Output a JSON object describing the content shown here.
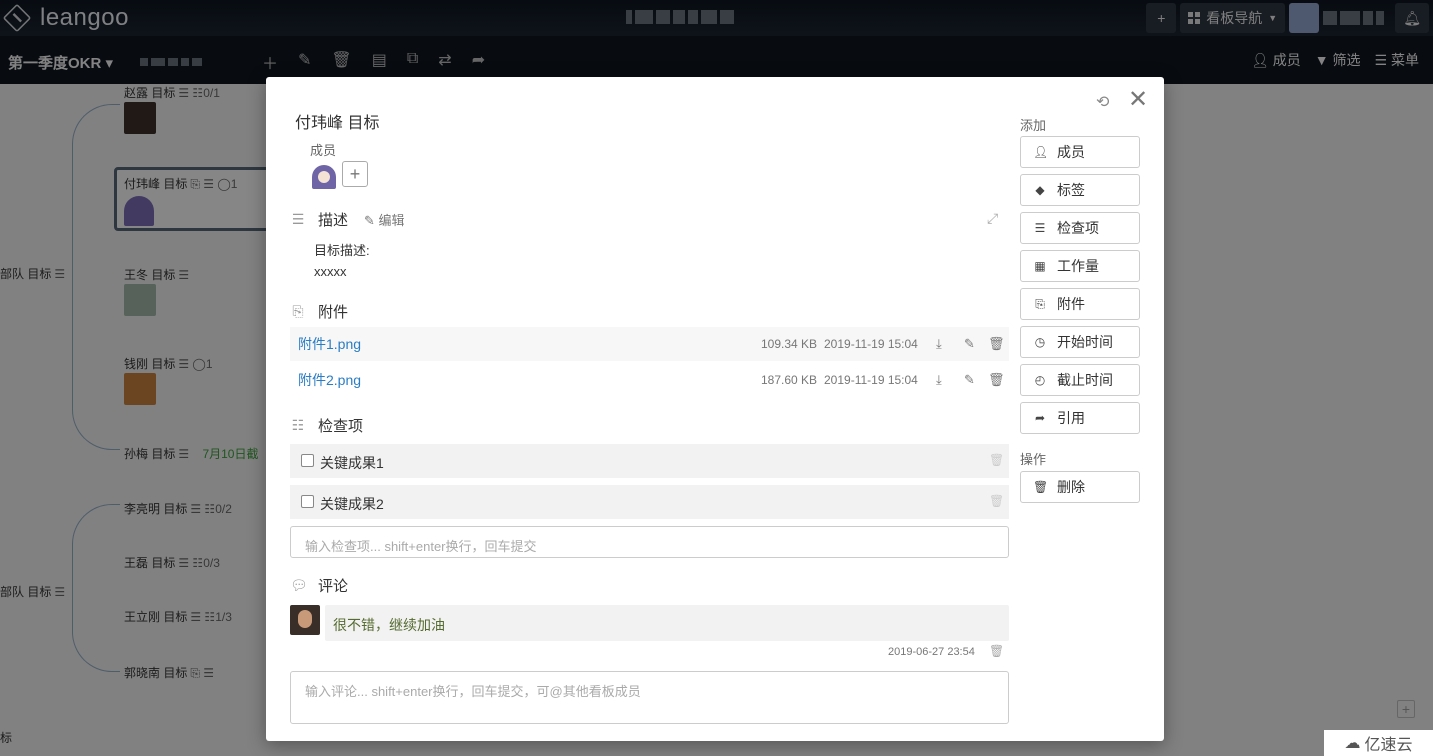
{
  "app": {
    "logo_text": "leangoo"
  },
  "topbar": {
    "add_label": "+",
    "board_nav_label": "看板导航",
    "bell_icon": "bell-icon"
  },
  "subbar": {
    "board_title": "第一季度OKR",
    "members_label": "成员",
    "filter_label": "筛选",
    "menu_label": "菜单"
  },
  "mindmap": {
    "nodes": [
      {
        "label": "赵露 目标",
        "meta": "☰ ☷0/1"
      },
      {
        "label": "付玮峰 目标",
        "meta": "⎘ ☰ ◯1"
      },
      {
        "label": "王冬 目标",
        "meta": "☰"
      },
      {
        "label": "钱刚 目标",
        "meta": "☰ ◯1"
      },
      {
        "label": "孙梅 目标",
        "meta": "☰",
        "due": "7月10日截"
      },
      {
        "label": "李亮明 目标",
        "meta": "☰ ☷0/2"
      },
      {
        "label": "王磊 目标",
        "meta": "☰ ☷0/3"
      },
      {
        "label": "王立刚 目标",
        "meta": "☰ ☷1/3"
      },
      {
        "label": "郭晓南 目标",
        "meta": "⎘ ☰"
      },
      {
        "label": "部队 目标",
        "meta": "☰"
      },
      {
        "label": "部队 目标",
        "meta": "☰"
      },
      {
        "label": "标",
        "meta": ""
      }
    ]
  },
  "modal": {
    "title": "付玮峰 目标",
    "members_label": "成员",
    "description": {
      "heading": "描述",
      "edit_label": "编辑",
      "line1": "目标描述:",
      "line2": "xxxxx"
    },
    "attachments": {
      "heading": "附件",
      "items": [
        {
          "name": "附件1.png",
          "size": "109.34 KB",
          "date": "2019-11-19 15:04"
        },
        {
          "name": "附件2.png",
          "size": "187.60 KB",
          "date": "2019-11-19 15:04"
        }
      ]
    },
    "checklist": {
      "heading": "检查项",
      "items": [
        {
          "label": "关键成果1",
          "checked": false
        },
        {
          "label": "关键成果2",
          "checked": false
        }
      ],
      "input_placeholder": "输入检查项... shift+enter换行，回车提交"
    },
    "comments": {
      "heading": "评论",
      "items": [
        {
          "text": "很不错，继续加油",
          "time": "2019-06-27 23:54"
        }
      ],
      "input_placeholder": "输入评论... shift+enter换行，回车提交，可@其他看板成员"
    },
    "sidebar": {
      "add_label": "添加",
      "add_buttons": [
        {
          "label": "成员",
          "icon": "add-user-icon"
        },
        {
          "label": "标签",
          "icon": "tag-icon"
        },
        {
          "label": "检查项",
          "icon": "list-icon"
        },
        {
          "label": "工作量",
          "icon": "grid-icon"
        },
        {
          "label": "附件",
          "icon": "paperclip-icon"
        },
        {
          "label": "开始时间",
          "icon": "clock-icon"
        },
        {
          "label": "截止时间",
          "icon": "clock-icon"
        },
        {
          "label": "引用",
          "icon": "share-icon"
        }
      ],
      "actions_label": "操作",
      "delete_label": "删除"
    }
  },
  "watermark": {
    "text": "亿速云"
  }
}
